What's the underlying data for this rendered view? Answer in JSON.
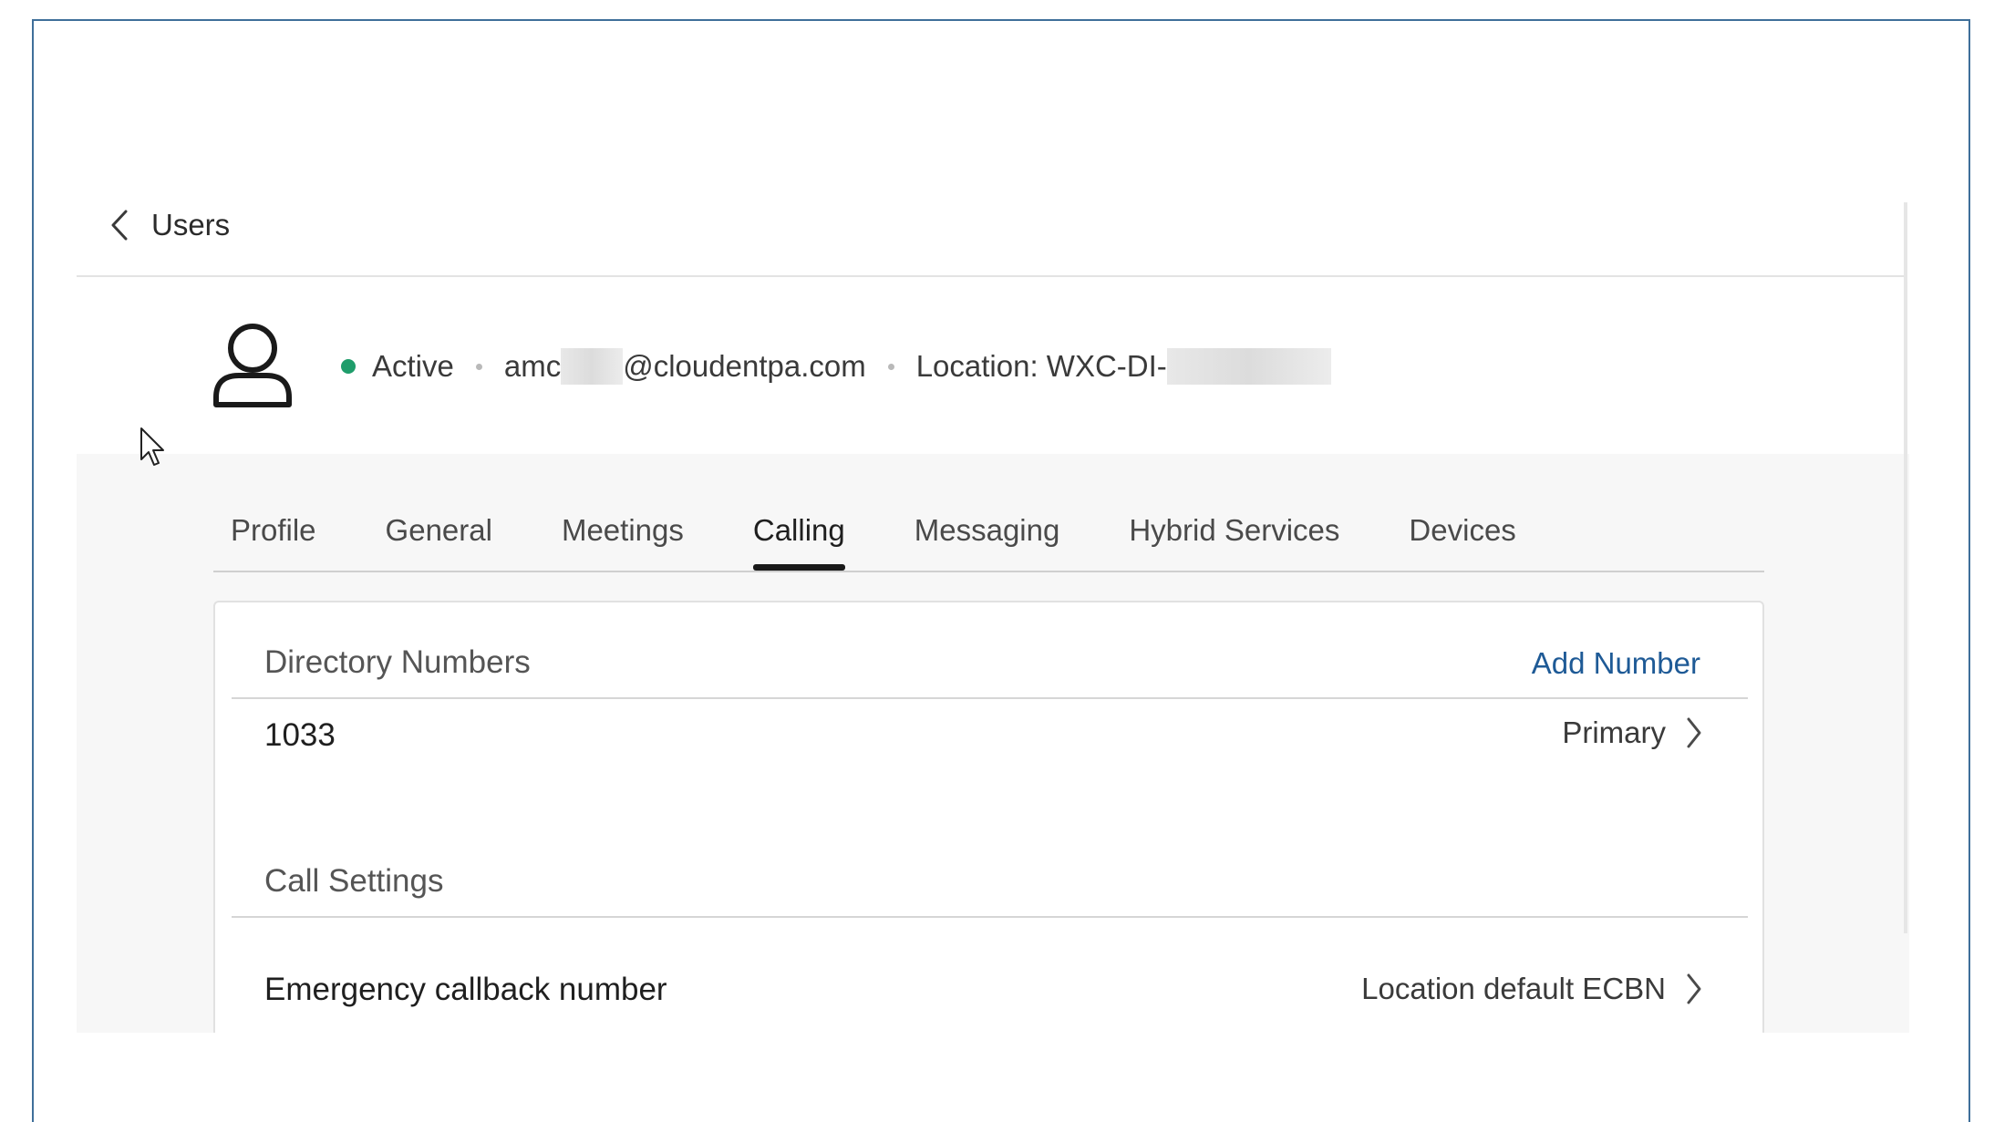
{
  "header": {
    "back_label": "Users"
  },
  "user": {
    "status": "Active",
    "status_color": "#1f9d6b",
    "email_prefix": "amc",
    "email_suffix": "@cloudentpa.com",
    "location_prefix": "Location: WXC-DI-"
  },
  "tabs": [
    {
      "label": "Profile",
      "active": false
    },
    {
      "label": "General",
      "active": false
    },
    {
      "label": "Meetings",
      "active": false
    },
    {
      "label": "Calling",
      "active": true
    },
    {
      "label": "Messaging",
      "active": false
    },
    {
      "label": "Hybrid Services",
      "active": false
    },
    {
      "label": "Devices",
      "active": false
    }
  ],
  "directory_numbers": {
    "title": "Directory Numbers",
    "add_label": "Add Number",
    "items": [
      {
        "number": "1033",
        "type": "Primary"
      }
    ]
  },
  "call_settings": {
    "title": "Call Settings",
    "items": [
      {
        "label": "Emergency callback number",
        "value": "Location default ECBN"
      }
    ]
  },
  "colors": {
    "link": "#1e5a96",
    "frame_border": "#3f6f9a"
  },
  "icons": {
    "back": "chevron-left-icon",
    "avatar": "user-icon",
    "row_arrow": "chevron-right-icon",
    "pointer": "mouse-cursor-icon"
  }
}
